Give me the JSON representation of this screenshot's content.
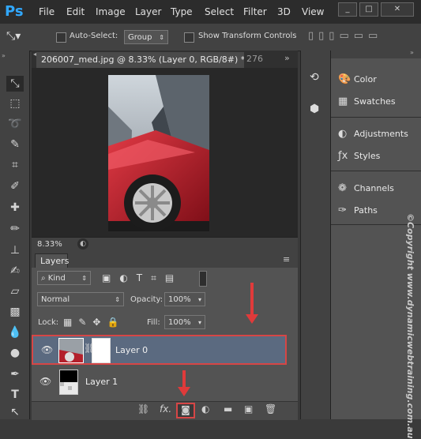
{
  "app": {
    "logo": "Ps"
  },
  "menu": [
    "File",
    "Edit",
    "Image",
    "Layer",
    "Type",
    "Select",
    "Filter",
    "3D",
    "View"
  ],
  "window_controls": {
    "minimize": "_",
    "maximize": "□",
    "close": "✕"
  },
  "options": {
    "auto_select_label": "Auto-Select:",
    "auto_select_value": "Group",
    "show_transform_label": "Show Transform Controls"
  },
  "document": {
    "tab_title": "206007_med.jpg @ 8.33% (Layer 0, RGB/8#) *",
    "tab_close": "×",
    "second_tab": "276",
    "zoom": "8.33%"
  },
  "layers_panel": {
    "tab_label": "Layers",
    "filter_value": "Kind",
    "blend_mode": "Normal",
    "opacity_label": "Opacity:",
    "opacity_value": "100%",
    "lock_label": "Lock:",
    "fill_label": "Fill:",
    "fill_value": "100%",
    "layers": [
      {
        "name": "Layer 0",
        "selected": true
      },
      {
        "name": "Layer 1",
        "selected": false
      }
    ],
    "fx_label": "fx."
  },
  "right_panel": {
    "items": [
      "Color",
      "Swatches",
      "Adjustments",
      "Styles",
      "Channels",
      "Paths"
    ]
  },
  "watermark": "©Copyright www.dynamicwebtraining.com.au",
  "colors": {
    "highlight": "#d64646",
    "arrow": "#e03a3a",
    "selected_layer": "#5b6a80"
  }
}
